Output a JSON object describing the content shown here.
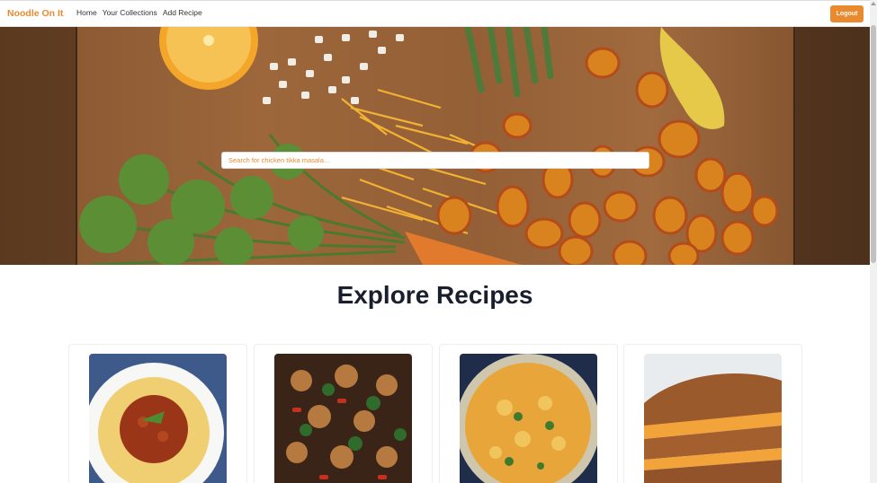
{
  "nav": {
    "brand": "Noodle On It",
    "links": [
      "Home",
      "Your Collections",
      "Add Recipe"
    ],
    "logout_label": "Logout"
  },
  "hero": {
    "search_placeholder": "Search for chicken tikka masala..."
  },
  "main": {
    "section_title": "Explore Recipes"
  },
  "colors": {
    "accent": "#e98a2f",
    "heading": "#1a1f2e"
  }
}
